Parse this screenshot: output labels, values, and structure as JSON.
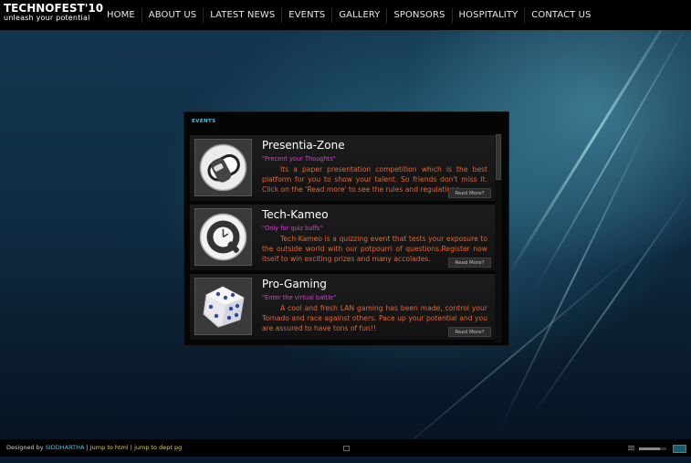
{
  "logo": {
    "title": "TECHNOFEST'10",
    "tagline": "unleash your potential"
  },
  "nav": {
    "items": [
      "HOME",
      "ABOUT US",
      "LATEST NEWS",
      "EVENTS",
      "GALLERY",
      "SPONSORS",
      "HOSPITALITY",
      "CONTACT US"
    ]
  },
  "panel": {
    "title": "EVENTS"
  },
  "events": [
    {
      "title": "Presentia-Zone",
      "tagline": "\"Precent your Thoughts\"",
      "description": "Its a paper presentation competition which is the best platform for you to show your talent. So friends don't miss it. Click on the 'Read more' to see the rules and regulations.",
      "read_more": "Read More?",
      "icon": "presentation-icon"
    },
    {
      "title": "Tech-Kameo",
      "tagline": "\"Only for quiz buffs\"",
      "description": "Tech-Kameo   is a quizzing event that tests your exposure to the outside world with our potpourri of questions.Register now itself to win exciting prizes and many accolades.",
      "read_more": "Read More?",
      "icon": "quicktime-icon"
    },
    {
      "title": "Pro-Gaming",
      "tagline": "\"Enter the virtual battle\"",
      "description": "A cool and fresh LAN gaming has been made, control your Tornado and race against others. Pace up your potential and you are assured to have tons of fun!!",
      "read_more": "Read More?",
      "icon": "dice-icon"
    }
  ],
  "footer": {
    "prefix": "Designed by ",
    "designer": "SIDDHARTHA",
    "sep1": " | ",
    "link1": "Jump to html",
    "sep2": " | ",
    "link2": "jump to dept pg"
  },
  "player": {
    "volume": 0.75
  },
  "colors": {
    "accent": "#3fc8e8",
    "tagline": "#d63cd6",
    "description": "#e8642a",
    "footer_link": "#e0d030"
  }
}
